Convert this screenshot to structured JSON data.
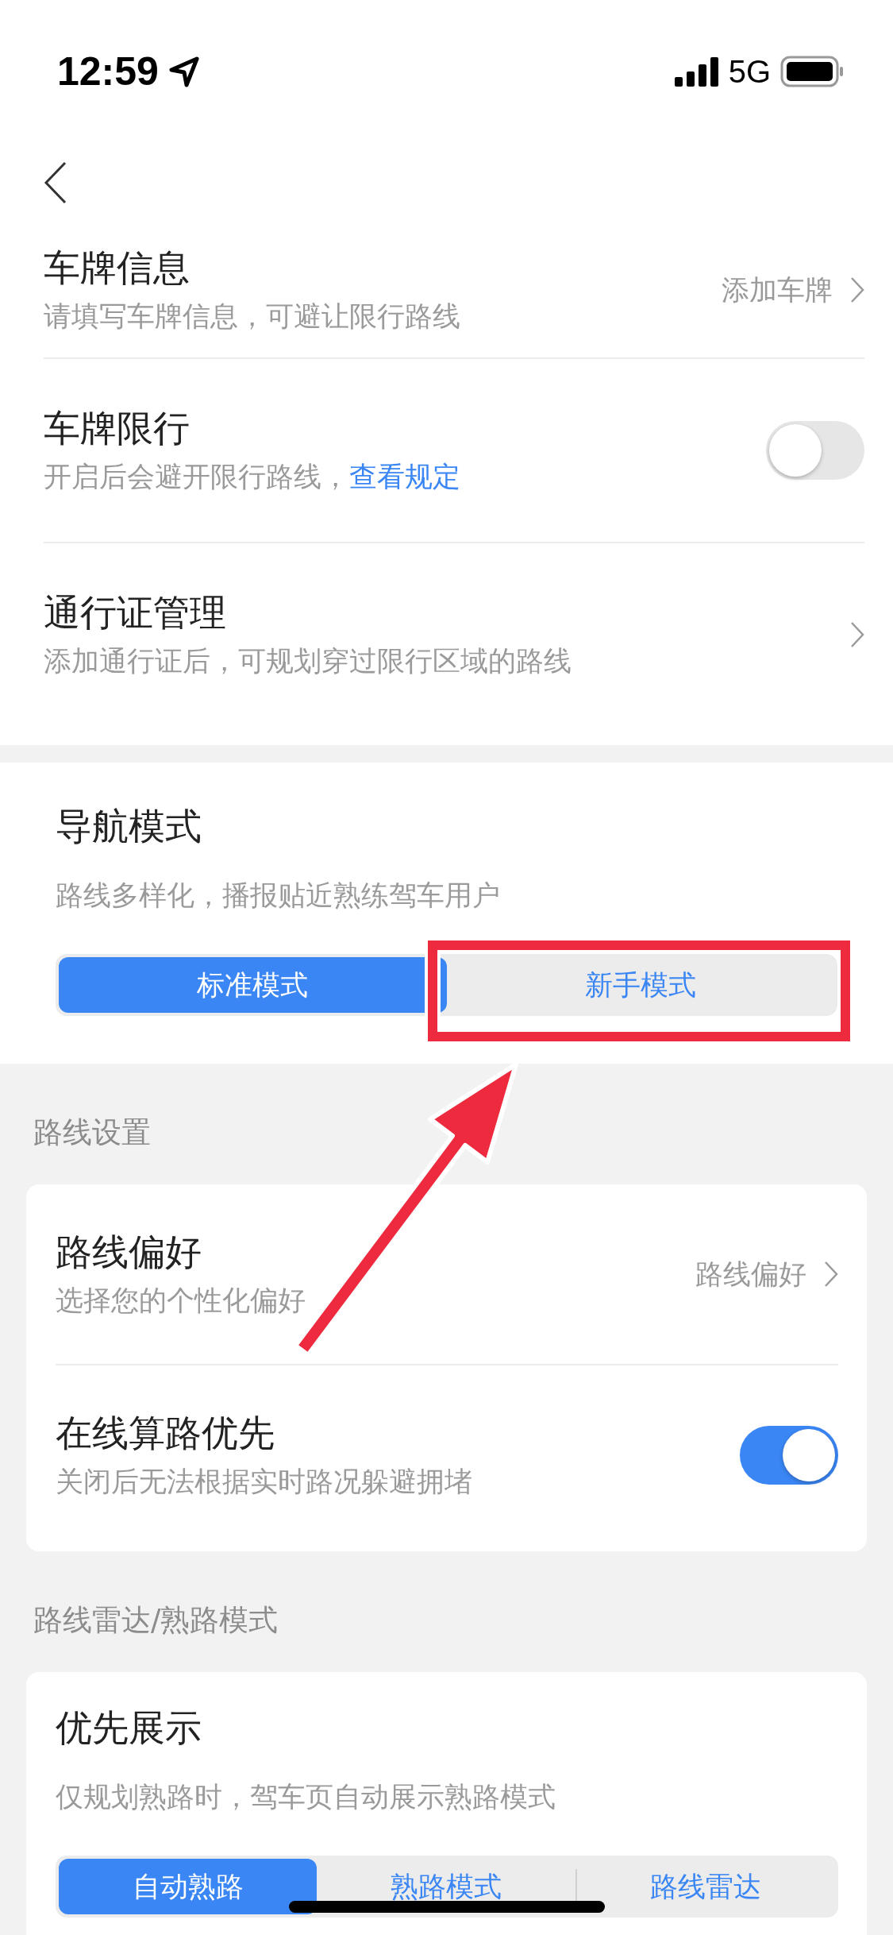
{
  "status_bar": {
    "time": "12:59",
    "network": "5G"
  },
  "plate_section": {
    "rows": [
      {
        "kind": "link",
        "title": "车牌信息",
        "subtitle": "请填写车牌信息，可避让限行路线",
        "value": "添加车牌"
      },
      {
        "kind": "toggle",
        "title": "车牌限行",
        "subtitle": "开启后会避开限行路线，",
        "link": "查看规定",
        "on": false
      },
      {
        "kind": "link",
        "title": "通行证管理",
        "subtitle": "添加通行证后，可规划穿过限行区域的路线"
      }
    ]
  },
  "nav_mode": {
    "title": "导航模式",
    "subtitle": "路线多样化，播报贴近熟练驾车用户",
    "options": [
      {
        "label": "标准模式",
        "selected": true
      },
      {
        "label": "新手模式",
        "selected": false
      }
    ]
  },
  "route_settings": {
    "heading": "路线设置",
    "rows": [
      {
        "kind": "link",
        "title": "路线偏好",
        "subtitle": "选择您的个性化偏好",
        "value": "路线偏好"
      },
      {
        "kind": "toggle",
        "title": "在线算路优先",
        "subtitle": "关闭后无法根据实时路况躲避拥堵",
        "on": true
      }
    ]
  },
  "radar": {
    "heading": "路线雷达/熟路模式",
    "title": "优先展示",
    "subtitle": "仅规划熟路时，驾车页自动展示熟路模式",
    "options": [
      {
        "label": "自动熟路",
        "selected": true
      },
      {
        "label": "熟路模式",
        "selected": false
      },
      {
        "label": "路线雷达",
        "selected": false
      }
    ]
  }
}
